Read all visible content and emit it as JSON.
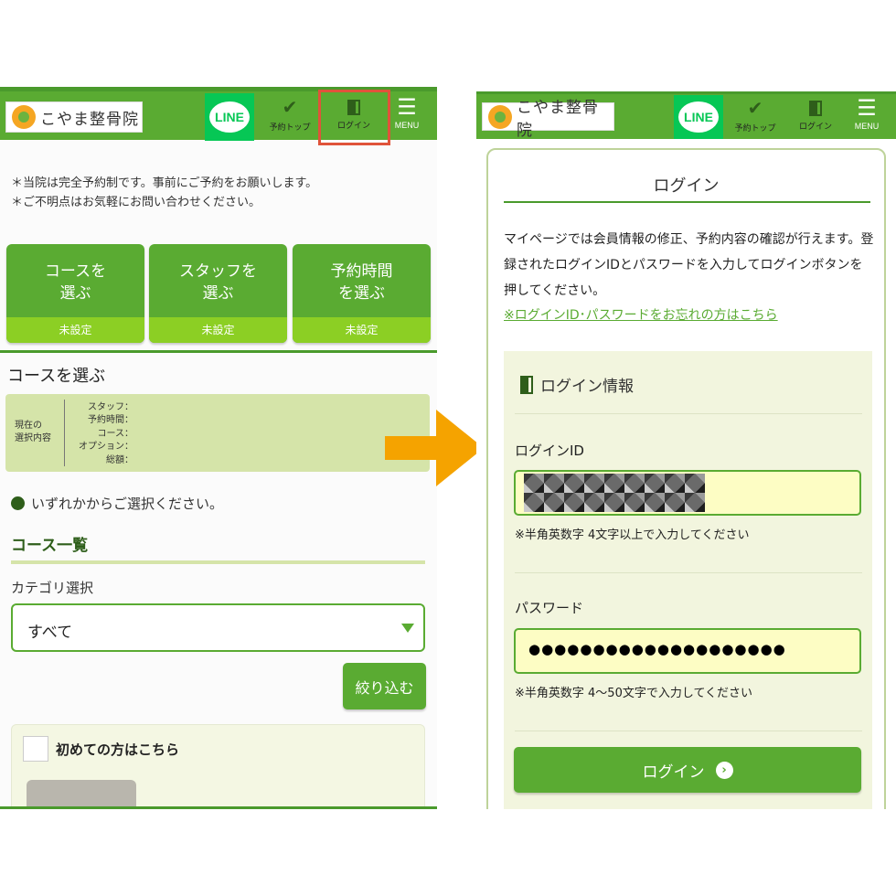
{
  "header": {
    "logo_text": "こやま整骨院",
    "line_label": "LINE",
    "nav_reserve_top": "予約トップ",
    "nav_login": "ログイン",
    "nav_menu": "MENU"
  },
  "left": {
    "notice_line1": "＊当院は完全予約制です。事前にご予約をお願いします。",
    "notice_line2": "＊ご不明点はお気軽にお問い合わせください。",
    "steps": [
      {
        "line1": "コースを",
        "line2": "選ぶ",
        "status": "未設定"
      },
      {
        "line1": "スタッフを",
        "line2": "選ぶ",
        "status": "未設定"
      },
      {
        "line1": "予約時間",
        "line2": "を選ぶ",
        "status": "未設定"
      }
    ],
    "section_title": "コースを選ぶ",
    "selection": {
      "head_line1": "現在の",
      "head_line2": "選択内容",
      "labels": [
        "スタッフ：",
        "予約時間：",
        "コース：",
        "オプション：",
        "総額："
      ]
    },
    "hint": "いずれかからご選択ください。",
    "course_list_title": "コース一覧",
    "category_label": "カテゴリ選択",
    "category_value": "すべて",
    "filter_button": "絞り込む",
    "card_title": "初めての方はこちら"
  },
  "right": {
    "login_title": "ログイン",
    "description": "マイページでは会員情報の修正、予約内容の確認が行えます。登録されたログインIDとパスワードを入力してログインボタンを押してください。",
    "forgot_link": "※ログインID･パスワードをお忘れの方はこちら",
    "form_heading": "ログイン情報",
    "id_label": "ログインID",
    "id_note": "※半角英数字 4文字以上で入力してください",
    "password_label": "パスワード",
    "password_value": "●●●●●●●●●●●●●●●●●●●●",
    "password_note": "※半角英数字 4〜50文字で入力してください",
    "login_button": "ログイン"
  },
  "colors": {
    "brand_green": "#5aab32",
    "dark_green": "#2e5e1a",
    "step_status_green": "#8ccf24",
    "arrow_orange": "#f5a300",
    "highlight_red": "#e0533a",
    "line_green": "#06c755"
  },
  "icons": {
    "check": "check-icon",
    "door": "door-icon",
    "menu": "hamburger-icon",
    "arrow": "right-arrow-icon",
    "chevron": "chevron-right-circle-icon"
  }
}
